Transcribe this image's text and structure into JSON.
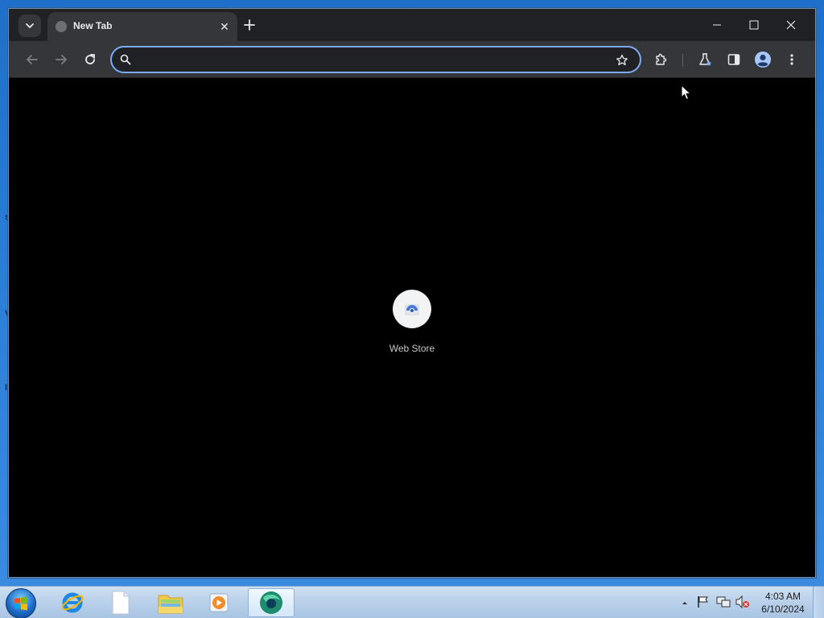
{
  "browser": {
    "tab": {
      "title": "New Tab"
    },
    "omnibox": {
      "value": "",
      "placeholder": ""
    },
    "accent_color": "#7cacf8"
  },
  "new_tab_page": {
    "shortcuts": [
      {
        "label": "Web Store",
        "icon": "web-store-icon"
      }
    ]
  },
  "taskbar": {
    "pinned_apps": [
      {
        "name": "internet-explorer",
        "icon": "internet-explorer-icon"
      },
      {
        "name": "document",
        "icon": "document-icon"
      },
      {
        "name": "file-explorer",
        "icon": "folder-icon"
      },
      {
        "name": "media-player",
        "icon": "media-player-icon"
      },
      {
        "name": "browser",
        "icon": "browser-icon",
        "active": true
      }
    ],
    "clock": {
      "time": "4:03 AM",
      "date": "6/10/2024"
    }
  }
}
